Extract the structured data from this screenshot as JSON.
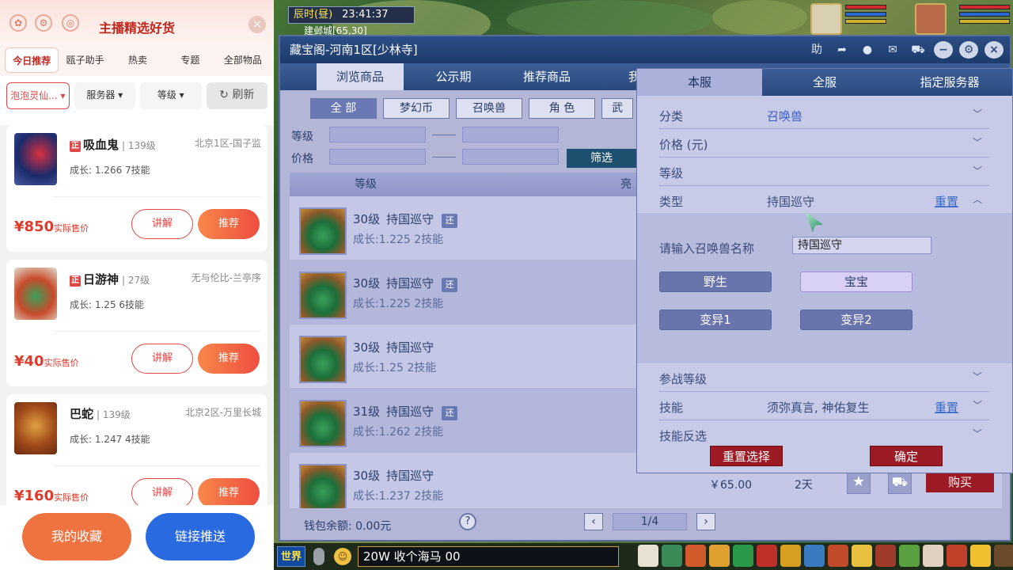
{
  "left_panel": {
    "title": "主播精选好货",
    "header_icons": [
      "flower-icon",
      "settings-icon",
      "shield-icon"
    ],
    "close_label": "×",
    "tabs": [
      "今日推荐",
      "瓯子助手",
      "热卖",
      "专题",
      "全部物品"
    ],
    "filters": {
      "type": "泡泡灵仙...",
      "server": "服务器",
      "level": "等级",
      "refresh": "刷新"
    },
    "cards": [
      {
        "name": "吸血鬼",
        "level": "139级",
        "server": "北京1区-国子监",
        "growth": "成长: 1.266 7技能",
        "price": "¥850",
        "price_note": "实际售价",
        "tag": "正"
      },
      {
        "name": "日游神",
        "level": "27级",
        "server": "无与伦比-兰亭序",
        "growth": "成长: 1.25 6技能",
        "price": "¥40",
        "price_note": "实际售价",
        "tag": "正"
      },
      {
        "name": "巴蛇",
        "level": "139级",
        "server": "北京2区-万里长城",
        "growth": "成长: 1.247 4技能",
        "price": "¥160",
        "price_note": "实际售价",
        "tag": ""
      }
    ],
    "btn_explain": "讲解",
    "btn_recommend": "推荐",
    "btn_fav": "我的收藏",
    "btn_push": "链接推送"
  },
  "hud": {
    "time_label": "辰时(昼)",
    "clock": "23:41:37",
    "location": "建邺城[65,30]"
  },
  "window": {
    "title": "藏宝阁-河南1区[少林寺]",
    "tabs": [
      "浏览商品",
      "公示期",
      "推荐商品",
      "我是"
    ],
    "categories": [
      "全 部",
      "梦幻币",
      "召唤兽",
      "角 色",
      "武"
    ],
    "filter_level": "等级",
    "filter_price": "价格",
    "filter_btn": "筛选",
    "col_level": "等级",
    "col_bright": "亮",
    "rows": [
      {
        "level": "30级",
        "name": "持国巡守",
        "tag": "还",
        "growth": "成长:1.225 2技能",
        "price": "",
        "days": ""
      },
      {
        "level": "30级",
        "name": "持国巡守",
        "tag": "还",
        "growth": "成长:1.225 2技能",
        "price": "",
        "days": ""
      },
      {
        "level": "30级",
        "name": "持国巡守",
        "tag": "",
        "growth": "成长:1.25 2技能",
        "price": "",
        "days": ""
      },
      {
        "level": "31级",
        "name": "持国巡守",
        "tag": "还",
        "growth": "成长:1.262 2技能",
        "price": "",
        "days": ""
      },
      {
        "level": "30级",
        "name": "持国巡守",
        "tag": "",
        "growth": "成长:1.237 2技能",
        "price": "￥65.00",
        "days": "2天"
      }
    ],
    "buy_label": "购买",
    "wallet": "钱包余额: 0.00元",
    "page": "1/4"
  },
  "popup": {
    "tabs": [
      "本服",
      "全服",
      "指定服务器"
    ],
    "category_label": "分类",
    "category_value": "召唤兽",
    "price_label": "价格 (元)",
    "level_label": "等级",
    "type_label": "类型",
    "type_value": "持国巡守",
    "reset": "重置",
    "name_label": "请输入召唤兽名称",
    "name_value": "持国巡守",
    "btn_wild": "野生",
    "btn_baby": "宝宝",
    "btn_mut1": "变异1",
    "btn_mut2": "变异2",
    "battle_label": "参战等级",
    "skill_label": "技能",
    "skill_value": "须弥真言, 神佑复生",
    "skill_rev_label": "技能反选",
    "btn_reset_sel": "重置选择",
    "btn_confirm": "确定"
  },
  "bottom_bar": {
    "world": "世界",
    "chat_text": "20W 收个海马 00"
  }
}
